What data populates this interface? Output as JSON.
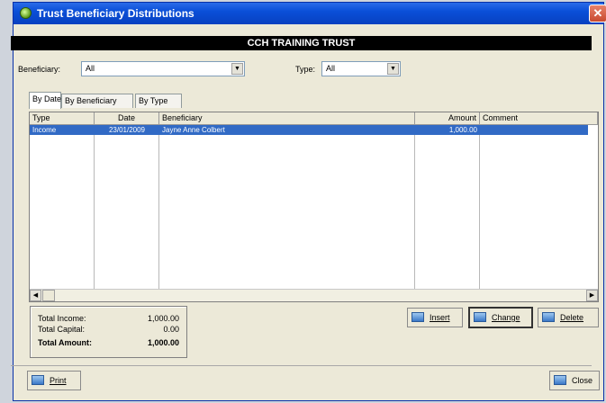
{
  "window": {
    "title": "Trust Beneficiary Distributions",
    "close_symbol": "✕"
  },
  "banner": {
    "text": "CCH TRAINING TRUST"
  },
  "filters": {
    "beneficiary_label": "Beneficiary:",
    "beneficiary_value": "All",
    "type_label": "Type:",
    "type_value": "All",
    "dropdown_arrow": "▼"
  },
  "tabs": [
    {
      "label": "By Date",
      "active": true
    },
    {
      "label": "By Beneficiary",
      "active": false
    },
    {
      "label": "By Type",
      "active": false
    }
  ],
  "table": {
    "columns": [
      "Type",
      "Date",
      "Beneficiary",
      "Amount",
      "Comment"
    ],
    "rows": [
      {
        "type": "Income",
        "date": "23/01/2009",
        "beneficiary": "Jayne Anne Colbert",
        "amount": "1,000.00",
        "comment": ""
      }
    ]
  },
  "scroll": {
    "left_arrow": "◀",
    "right_arrow": "▶"
  },
  "totals": {
    "income_label": "Total Income:",
    "income_value": "1,000.00",
    "capital_label": "Total Capital:",
    "capital_value": "0.00",
    "amount_label": "Total Amount:",
    "amount_value": "1,000.00"
  },
  "buttons": {
    "insert": "Insert",
    "change": "Change",
    "delete": "Delete",
    "print": "Print",
    "close": "Close"
  }
}
